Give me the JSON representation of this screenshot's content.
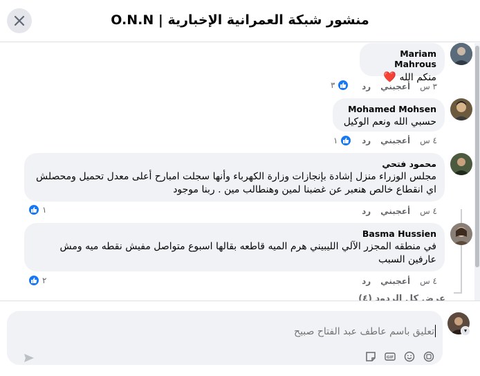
{
  "header": {
    "title": "منشور شبكة العمرانية الإخبارية | O.N.N",
    "close_icon": "close-icon"
  },
  "comments": [
    {
      "author": "Mariam Mahrous",
      "text": "منكم الله",
      "emoji": "❤️",
      "time": "٣ س",
      "like_label": "أعجبني",
      "reply_label": "رد",
      "reactions": "٣"
    },
    {
      "author": "Mohamed Mohsen",
      "text": "حسبي الله ونعم الوكيل",
      "time": "٤ س",
      "like_label": "أعجبني",
      "reply_label": "رد",
      "reactions": "١"
    },
    {
      "author": "محمود فتحي",
      "text": "مجلس الوزراء منزل إشادة بإنجازات وزارة الكهرباء وأنها سجلت امبارح أعلى معدل تحميل ومحصلش اي انقطاع خالص هنعبر عن غضبنا لمين وهنطالب مين . ربنا موجود",
      "time": "٤ س",
      "like_label": "أعجبني",
      "reply_label": "رد",
      "reactions": "١"
    },
    {
      "author": "Basma Hussien",
      "text": "في منطقه المجزر الآلي الليبيني هرم الميه قاطعه بقالها اسبوع متواصل مفيش نقطه ميه ومش عارفين السبب",
      "time": "٤ س",
      "like_label": "أعجبني",
      "reply_label": "رد",
      "reactions": "٢"
    }
  ],
  "view_all_replies": "عرض كل الردود (٤)",
  "composer": {
    "placeholder": "تعليق باسم عاطف عبد الفتاح صبيح"
  },
  "colors": {
    "accent": "#1877f2",
    "bubble": "#f0f2f5",
    "heart": "#e41e3f"
  }
}
